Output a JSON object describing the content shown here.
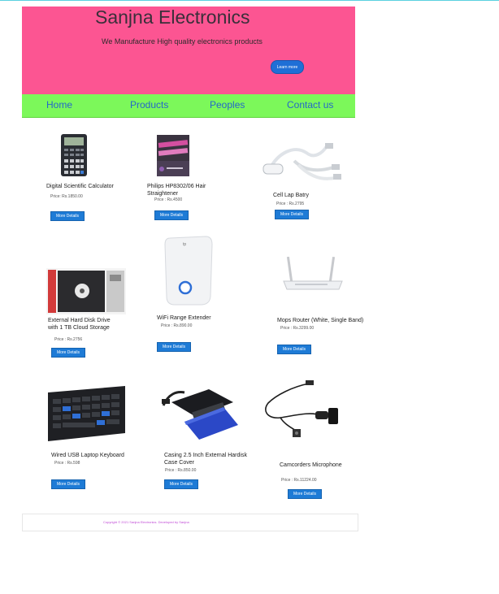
{
  "header": {
    "title": "Sanjna Electronics",
    "tagline": "We Manufacture High quality electronics  products",
    "cta": "Learn more"
  },
  "nav": {
    "items": [
      "Home",
      "Products",
      "Peoples",
      "Contact us"
    ]
  },
  "products": [
    {
      "name": "Digital Scientific Calculator",
      "price": "Price: Rs.1850.00",
      "button": "More Details"
    },
    {
      "name": "Philips HP8302/06 Hair\nStraightener",
      "price": "Price : Rs.4500",
      "button": "More Details"
    },
    {
      "name": "Cell Lap Batry",
      "price": "Price : Rs.2795",
      "button": "More Details"
    },
    {
      "name": "External Hard Disk Drive\nwith 1 TB Cloud Storage",
      "price": "Price : Rs.2756",
      "button": "More Details"
    },
    {
      "name": "WiFi Range Extender",
      "price": "Price : Rs.890.00",
      "button": "More Details"
    },
    {
      "name": "Mops Router  (White, Single Band)",
      "price": "Price : Rs.3299.00",
      "button": "More Details"
    },
    {
      "name": "Wired USB Laptop Keyboard",
      "price": "Price : Rs.598",
      "button": "More Details"
    },
    {
      "name": "Casing 2.5 Inch External Hardisk\nCase Cover",
      "price": "Price : Rs.850.00",
      "button": "More Details"
    },
    {
      "name": "Camcorders Microphone",
      "price": "Price : Rs.11224.00",
      "button": "More Details"
    }
  ],
  "footer": {
    "text": "Copyright © 2021 Sanjna Electronics. Developed by Sanjna"
  },
  "colors": {
    "header_bg": "#fc5592",
    "nav_bg": "#7cf85a",
    "nav_text": "#2567c9",
    "button_bg": "#1e7bd6"
  }
}
